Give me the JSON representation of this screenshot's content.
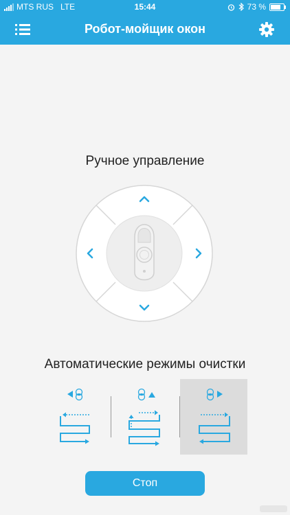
{
  "status_bar": {
    "carrier": "MTS RUS",
    "network": "LTE",
    "time": "15:44",
    "battery": "73 %"
  },
  "header": {
    "title": "Робот-мойщик окон",
    "menu_icon": "list-icon",
    "settings_icon": "gear-icon"
  },
  "manual": {
    "title": "Ручное управление"
  },
  "auto": {
    "title": "Автоматические режимы очистки",
    "modes": [
      {
        "name": "left-pattern",
        "selected": false
      },
      {
        "name": "up-pattern",
        "selected": false
      },
      {
        "name": "right-pattern",
        "selected": true
      }
    ]
  },
  "stop": {
    "label": "Стоп"
  },
  "colors": {
    "accent": "#29a8e0",
    "background": "#f4f4f4",
    "selected_mode": "#dcdcdc"
  }
}
